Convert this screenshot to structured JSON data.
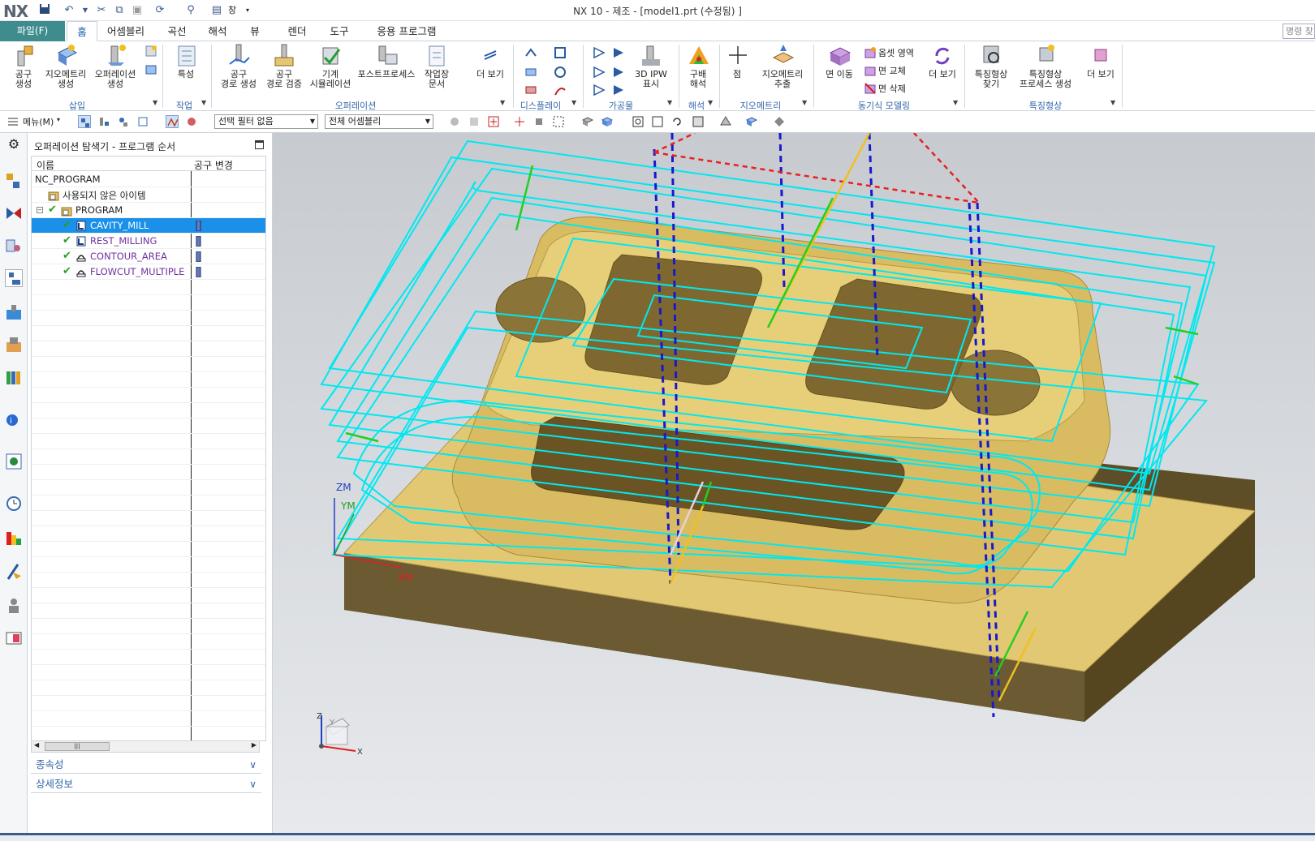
{
  "app": {
    "logo": "NX",
    "window_title": "NX 10 - 제조 - [model1.prt (수정됨) ]",
    "window_menu": "창"
  },
  "menu_tabs": {
    "file": "파일(F)",
    "tabs": [
      "홈",
      "어셈블리",
      "곡선",
      "해석",
      "뷰",
      "렌더",
      "도구",
      "응용 프로그램"
    ],
    "active": "홈",
    "command_search": "명령 찾"
  },
  "ribbon": {
    "create_tool": "공구\n생성",
    "create_geometry": "지오메트리\n생성",
    "create_operation": "오퍼레이션\n생성",
    "group_insert": "삽입",
    "feature": "특성",
    "group_work": "작업",
    "generate_toolpath": "공구\n경로 생성",
    "verify_toolpath": "공구\n경로 검증",
    "machine_simulation": "기계\n시뮬레이션",
    "postprocess": "포스트프로세스",
    "shop_doc": "작업장\n문서",
    "more_1": "더 보기",
    "group_operation": "오퍼레이션",
    "group_display": "디스플레이",
    "ipw_3d": "3D IPW\n표시",
    "group_workpiece": "가공물",
    "slope_analysis": "구배\n해석",
    "group_analysis": "해석",
    "point": "점",
    "extract_geometry": "지오메트리\n추출",
    "group_geometry": "지오메트리",
    "move_face": "면 이동",
    "offset_region": "옵셋 영역",
    "replace_face": "면 교체",
    "delete_face": "면 삭제",
    "more_2": "더 보기",
    "group_sync": "동기식 모델링",
    "find_features": "특징형상\n찾기",
    "feature_process": "특징형상\n프로세스 생성",
    "more_3": "더 보기",
    "group_features": "특징형상"
  },
  "toolbar": {
    "menu_label": "메뉴(M)",
    "selection_filter": "선택 필터 없음",
    "assembly_scope": "전체 어셈블리"
  },
  "navigator": {
    "title": "오퍼레이션 탐색기 - 프로그램 순서",
    "col_name": "이름",
    "col_tool_change": "공구 변경",
    "rows": [
      {
        "name": "NC_PROGRAM",
        "level": 0
      },
      {
        "name": "사용되지 않은 아이템",
        "level": 1
      },
      {
        "name": "PROGRAM",
        "level": 1
      },
      {
        "name": "CAVITY_MILL",
        "level": 2,
        "selected": true
      },
      {
        "name": "REST_MILLING",
        "level": 2
      },
      {
        "name": "CONTOUR_AREA",
        "level": 2
      },
      {
        "name": "FLOWCUT_MULTIPLE",
        "level": 2
      }
    ],
    "dependencies": "종속성",
    "details": "상세정보"
  },
  "viewport": {
    "zm": "ZM",
    "ym": "YM",
    "xm": "XM",
    "triad_z": "Z",
    "triad_y": "Y",
    "triad_x": "X"
  },
  "colors": {
    "file_tab": "#3f8c8f",
    "selection": "#1a90e8",
    "toolpath": "#00e8f0",
    "part_top": "#e3c874",
    "part_side": "#6b5a32",
    "rapid": "#1818cc",
    "link": "#e82020"
  }
}
